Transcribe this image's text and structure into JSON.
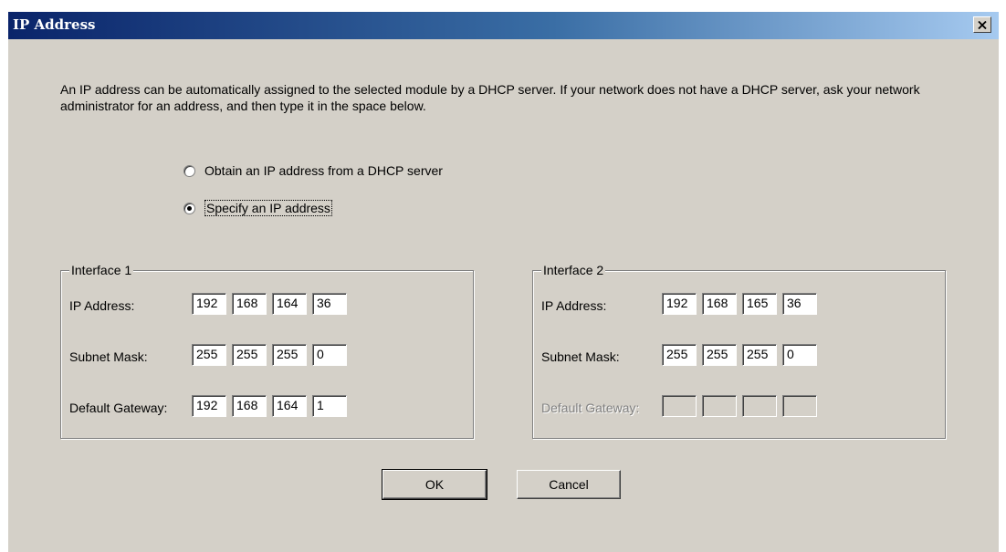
{
  "window": {
    "title": "IP Address",
    "close_icon": "close-icon"
  },
  "intro_text": "An IP address can be automatically assigned to the selected module by a DHCP server. If your network does not have a DHCP server, ask your network administrator for an address, and then type it in the space below.",
  "radios": [
    {
      "label": "Obtain an IP address from a DHCP server",
      "selected": false
    },
    {
      "label": "Specify an IP address",
      "selected": true
    }
  ],
  "interfaces": [
    {
      "title": "Interface 1",
      "ip_label": "IP Address:",
      "subnet_label": "Subnet Mask:",
      "gateway_label": "Default Gateway:",
      "ip": [
        "192",
        "168",
        "164",
        "36"
      ],
      "subnet": [
        "255",
        "255",
        "255",
        "0"
      ],
      "gateway": [
        "192",
        "168",
        "164",
        "1"
      ],
      "gateway_enabled": true
    },
    {
      "title": "Interface 2",
      "ip_label": "IP Address:",
      "subnet_label": "Subnet Mask:",
      "gateway_label": "Default Gateway:",
      "ip": [
        "192",
        "168",
        "165",
        "36"
      ],
      "subnet": [
        "255",
        "255",
        "255",
        "0"
      ],
      "gateway": [
        "",
        "",
        "",
        ""
      ],
      "gateway_enabled": false
    }
  ],
  "buttons": {
    "ok": "OK",
    "cancel": "Cancel"
  }
}
